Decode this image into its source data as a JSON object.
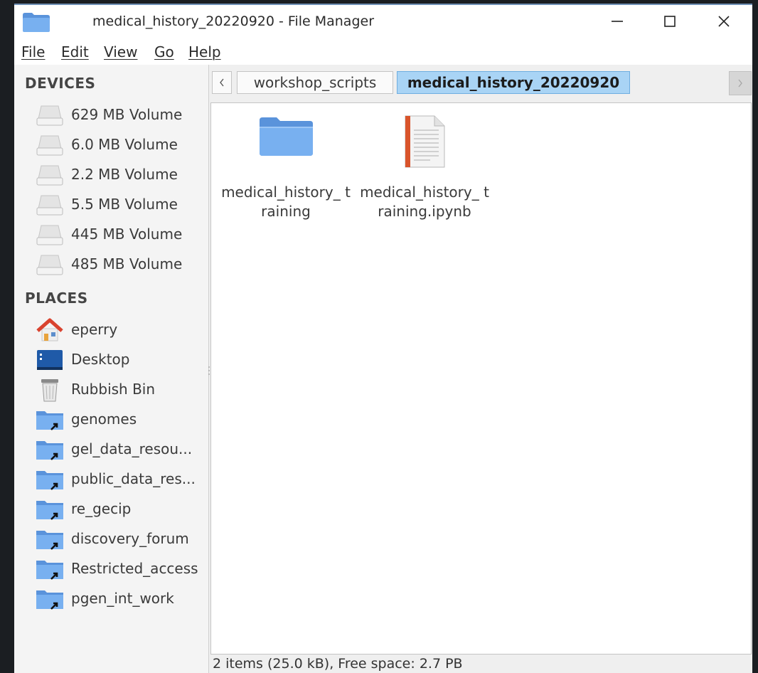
{
  "window": {
    "title": "medical_history_20220920 - File Manager"
  },
  "menu": [
    {
      "label": "File"
    },
    {
      "label": "Edit"
    },
    {
      "label": "View"
    },
    {
      "label": "Go"
    },
    {
      "label": "Help"
    }
  ],
  "sidebar": {
    "devices_header": "DEVICES",
    "devices": [
      {
        "label": "629 MB Volume",
        "icon": "drive-icon"
      },
      {
        "label": "6.0 MB Volume",
        "icon": "drive-icon"
      },
      {
        "label": "2.2 MB Volume",
        "icon": "drive-icon"
      },
      {
        "label": "5.5 MB Volume",
        "icon": "drive-icon"
      },
      {
        "label": "445 MB Volume",
        "icon": "drive-icon"
      },
      {
        "label": "485 MB Volume",
        "icon": "drive-icon"
      }
    ],
    "places_header": "PLACES",
    "places": [
      {
        "label": "eperry",
        "icon": "home-icon"
      },
      {
        "label": "Desktop",
        "icon": "desktop-icon"
      },
      {
        "label": "Rubbish Bin",
        "icon": "trash-icon"
      },
      {
        "label": "genomes",
        "icon": "folder-link-icon"
      },
      {
        "label": "gel_data_resou...",
        "icon": "folder-link-icon"
      },
      {
        "label": "public_data_res...",
        "icon": "folder-link-icon"
      },
      {
        "label": "re_gecip",
        "icon": "folder-link-icon"
      },
      {
        "label": "discovery_forum",
        "icon": "folder-link-icon"
      },
      {
        "label": "Restricted_access",
        "icon": "folder-link-icon"
      },
      {
        "label": "pgen_int_work",
        "icon": "folder-link-icon"
      }
    ]
  },
  "pathbar": {
    "crumbs": [
      {
        "label": "workshop_scripts",
        "selected": false
      },
      {
        "label": "medical_history_20220920",
        "selected": true
      }
    ]
  },
  "files": [
    {
      "name": "medical_history_ training",
      "icon": "folder-icon"
    },
    {
      "name": "medical_history_ training.ipynb",
      "icon": "text-document-icon"
    }
  ],
  "status": {
    "text": "2 items (25.0 kB), Free space: 2.7 PB"
  },
  "colors": {
    "accent": "#a9d4f5",
    "folder": "#6fa7e8",
    "titlebar_border": "#6e8fb5"
  }
}
